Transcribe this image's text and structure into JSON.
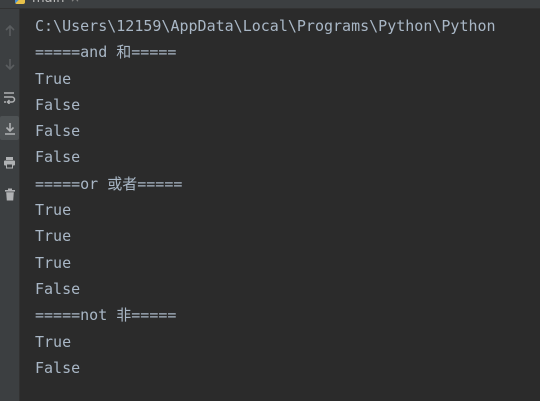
{
  "run_tab": {
    "label": "main",
    "close_glyph": "×",
    "icon": "python-file-icon"
  },
  "toolbar": {
    "items": [
      {
        "name": "up-arrow-icon",
        "enabled": false
      },
      {
        "name": "down-arrow-icon",
        "enabled": false
      },
      {
        "name": "soft-wrap-icon",
        "enabled": true
      },
      {
        "name": "scroll-to-end-icon",
        "enabled": true,
        "active": true
      },
      {
        "name": "print-icon",
        "enabled": true
      },
      {
        "name": "trash-icon",
        "enabled": true
      }
    ]
  },
  "console": {
    "lines": [
      "C:\\Users\\12159\\AppData\\Local\\Programs\\Python\\Python",
      "=====and 和=====",
      "True",
      "False",
      "False",
      "False",
      "=====or 或者=====",
      "True",
      "True",
      "True",
      "False",
      "=====not 非=====",
      "True",
      "False"
    ]
  },
  "colors": {
    "background": "#2b2b2b",
    "toolbar": "#3c3f41",
    "text": "#a9b7c6",
    "icon": "#afb1b3",
    "icon_disabled": "#5a5d5f"
  }
}
